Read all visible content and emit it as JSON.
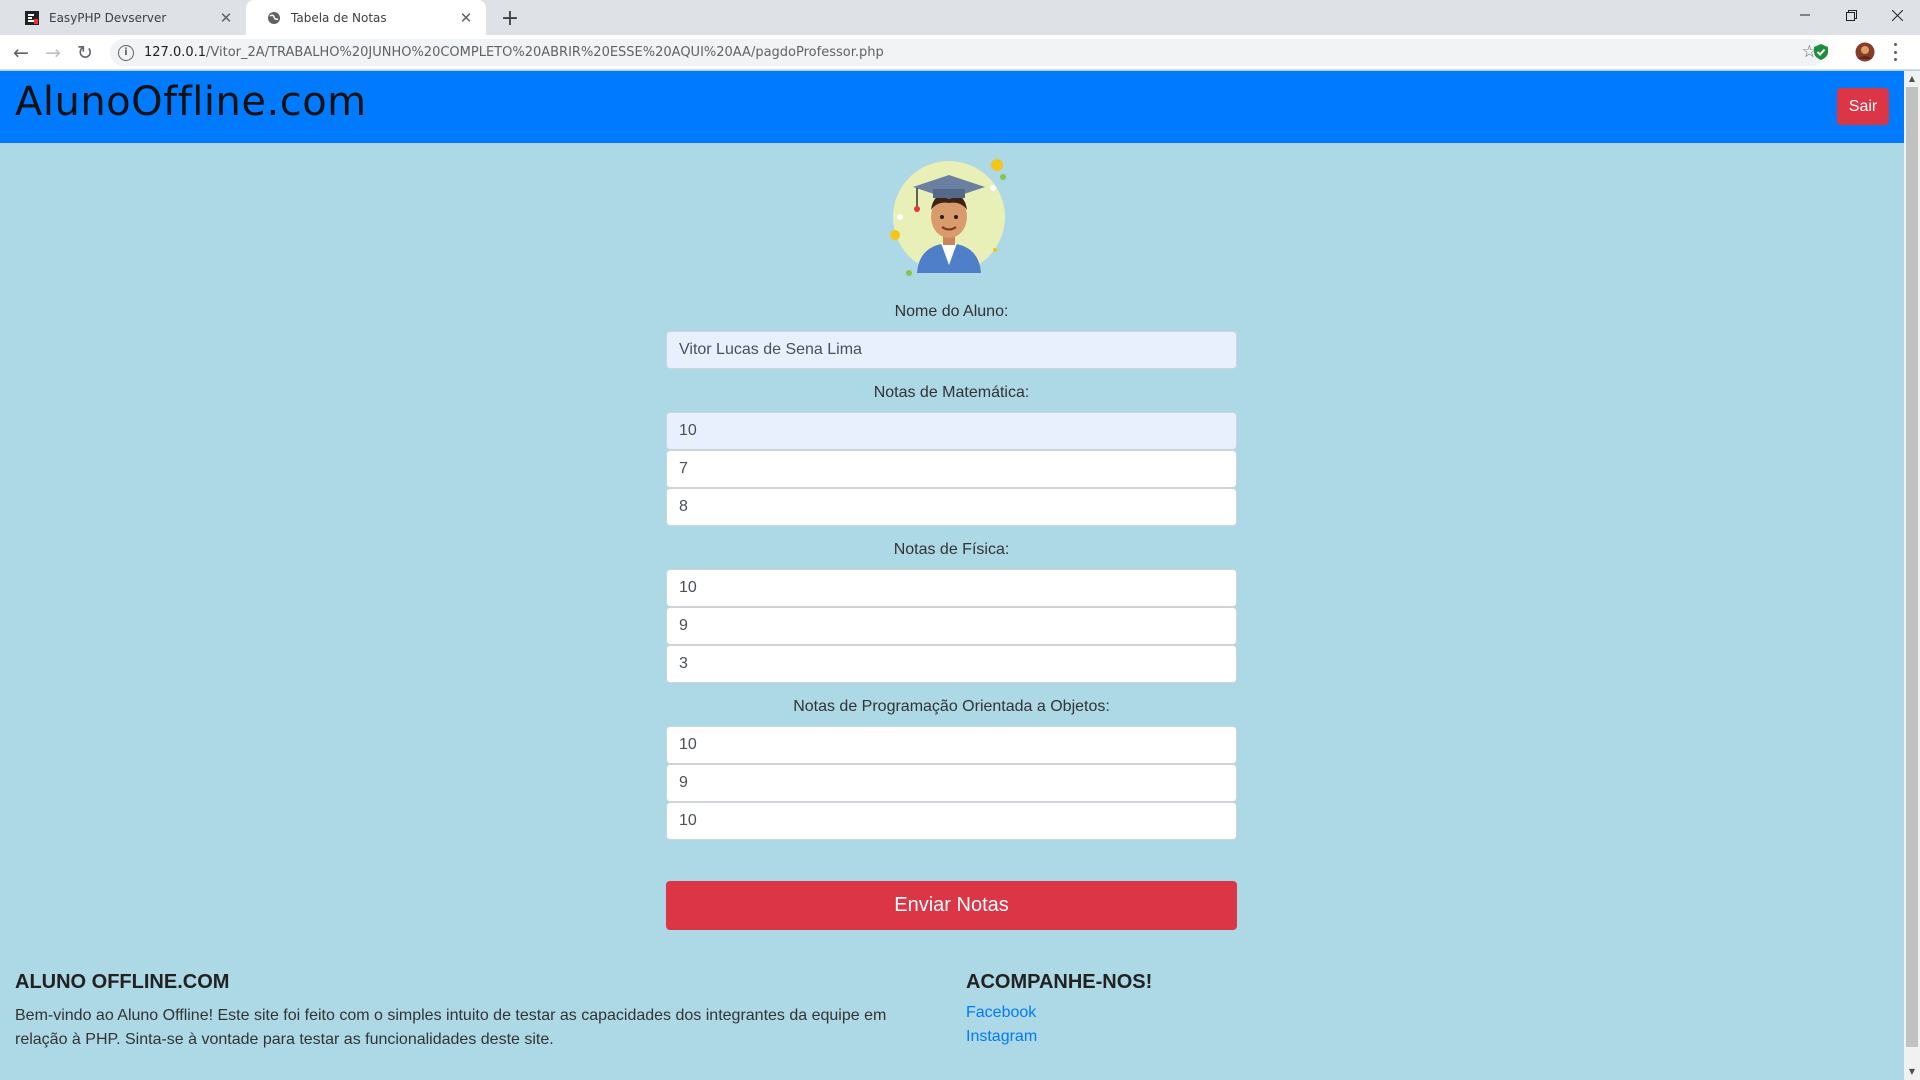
{
  "browser": {
    "tabs": [
      {
        "title": "EasyPHP Devserver",
        "icon": "easyphp-icon",
        "active": false
      },
      {
        "title": "Tabela de Notas",
        "icon": "globe-icon",
        "active": true
      }
    ],
    "url_host": "127.0.0.1",
    "url_path": "/Vitor_2A/TRABALHO%20JUNHO%20COMPLETO%20ABRIR%20ESSE%20AQUI%20AA/pagdoProfessor.php"
  },
  "header": {
    "brand": "AlunoOffline.com",
    "logout_label": "Sair",
    "bg_color": "#007bff",
    "logout_color": "#dc3545"
  },
  "form": {
    "student_label": "Nome do Aluno:",
    "student_name": "Vitor Lucas de Sena Lima",
    "math_label": "Notas de Matemática:",
    "math_grades": [
      "10",
      "7",
      "8"
    ],
    "physics_label": "Notas de Física:",
    "physics_grades": [
      "10",
      "9",
      "3"
    ],
    "oop_label": "Notas de Programação Orientada a Objetos:",
    "oop_grades": [
      "10",
      "9",
      "10"
    ],
    "submit_label": "Enviar Notas"
  },
  "footer": {
    "about_title": "ALUNO OFFLINE.COM",
    "about_text": "Bem-vindo ao Aluno Offline! Este site foi feito com o simples intuito de testar as capacidades dos integrantes da equipe em relação à PHP. Sinta-se à vontade para testar as funcionalidades deste site.",
    "follow_title": "ACOMPANHE-NOS!",
    "links": [
      "Facebook",
      "Instagram"
    ]
  },
  "colors": {
    "page_bg": "#add8e6",
    "link": "#007bff"
  }
}
